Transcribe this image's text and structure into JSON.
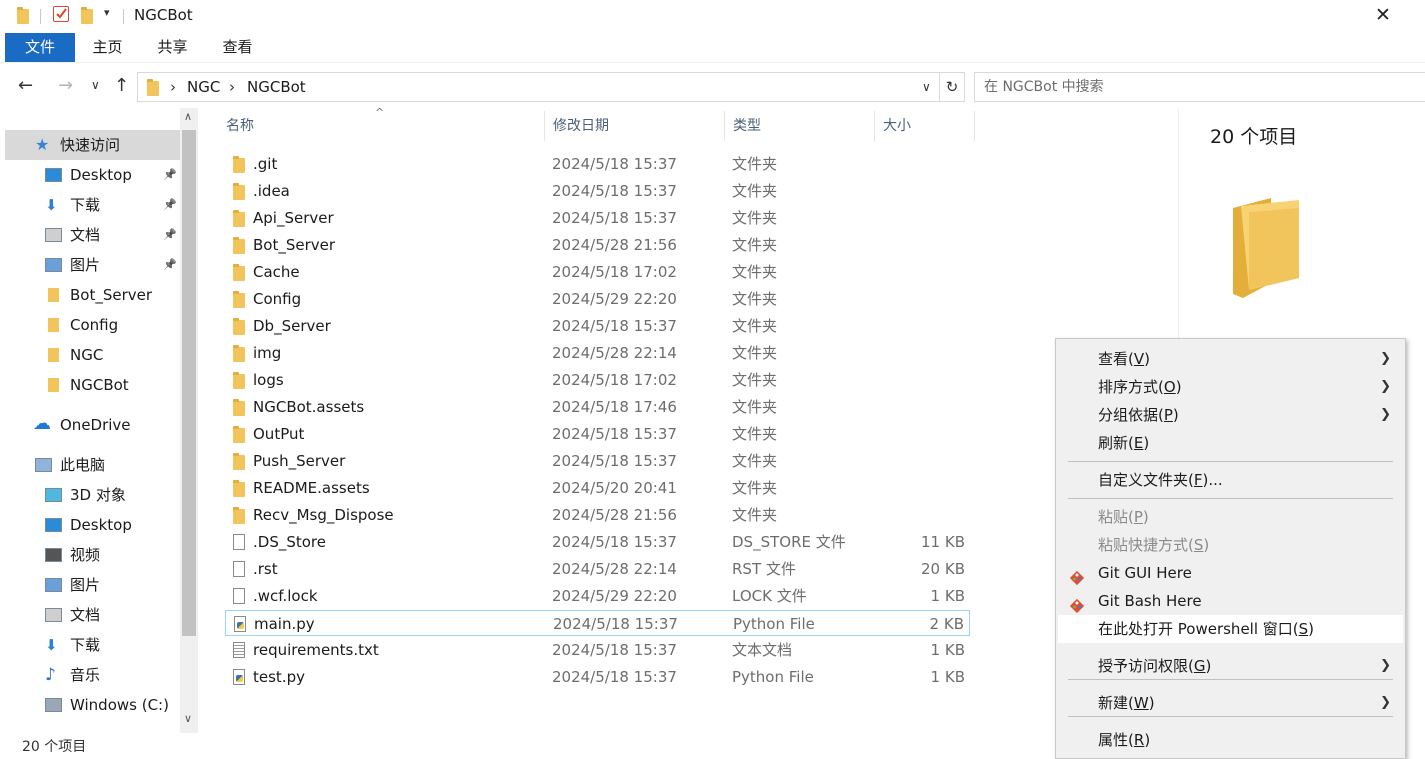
{
  "window": {
    "title": "NGCBot",
    "close_glyph": "✕"
  },
  "ribbon": {
    "tabs": [
      "文件",
      "主页",
      "共享",
      "查看"
    ]
  },
  "address": {
    "breadcrumbs": [
      "NGC",
      "NGCBot"
    ],
    "search_placeholder": "在 NGCBot 中搜索"
  },
  "nav": {
    "items": [
      {
        "label": "快速访问",
        "icon": "star-icon",
        "pinned": false
      },
      {
        "label": "Desktop",
        "icon": "desktop-icon",
        "pinned": true
      },
      {
        "label": "下载",
        "icon": "download-icon",
        "pinned": true
      },
      {
        "label": "文档",
        "icon": "document-icon",
        "pinned": true
      },
      {
        "label": "图片",
        "icon": "picture-icon",
        "pinned": true
      },
      {
        "label": "Bot_Server",
        "icon": "folder-icon",
        "pinned": false
      },
      {
        "label": "Config",
        "icon": "folder-icon",
        "pinned": false
      },
      {
        "label": "NGC",
        "icon": "folder-icon",
        "pinned": false
      },
      {
        "label": "NGCBot",
        "icon": "folder-icon",
        "pinned": false
      },
      {
        "label": "OneDrive",
        "icon": "onedrive-icon",
        "pinned": false
      },
      {
        "label": "此电脑",
        "icon": "pc-icon",
        "pinned": false
      },
      {
        "label": "3D 对象",
        "icon": "3d-objects-icon",
        "pinned": false
      },
      {
        "label": "Desktop",
        "icon": "desktop-icon",
        "pinned": false
      },
      {
        "label": "视频",
        "icon": "video-icon",
        "pinned": false
      },
      {
        "label": "图片",
        "icon": "picture-icon",
        "pinned": false
      },
      {
        "label": "文档",
        "icon": "document-icon",
        "pinned": false
      },
      {
        "label": "下载",
        "icon": "download-icon",
        "pinned": false
      },
      {
        "label": "音乐",
        "icon": "music-icon",
        "pinned": false
      },
      {
        "label": "Windows (C:)",
        "icon": "drive-icon",
        "pinned": false
      }
    ]
  },
  "columns": {
    "name": "名称",
    "date": "修改日期",
    "type": "类型",
    "size": "大小"
  },
  "files": [
    {
      "name": ".git",
      "date": "2024/5/18 15:37",
      "type": "文件夹",
      "size": "",
      "kind": "folder"
    },
    {
      "name": ".idea",
      "date": "2024/5/18 15:37",
      "type": "文件夹",
      "size": "",
      "kind": "folder"
    },
    {
      "name": "Api_Server",
      "date": "2024/5/18 15:37",
      "type": "文件夹",
      "size": "",
      "kind": "folder"
    },
    {
      "name": "Bot_Server",
      "date": "2024/5/28 21:56",
      "type": "文件夹",
      "size": "",
      "kind": "folder"
    },
    {
      "name": "Cache",
      "date": "2024/5/18 17:02",
      "type": "文件夹",
      "size": "",
      "kind": "folder"
    },
    {
      "name": "Config",
      "date": "2024/5/29 22:20",
      "type": "文件夹",
      "size": "",
      "kind": "folder"
    },
    {
      "name": "Db_Server",
      "date": "2024/5/18 15:37",
      "type": "文件夹",
      "size": "",
      "kind": "folder"
    },
    {
      "name": "img",
      "date": "2024/5/28 22:14",
      "type": "文件夹",
      "size": "",
      "kind": "folder"
    },
    {
      "name": "logs",
      "date": "2024/5/18 17:02",
      "type": "文件夹",
      "size": "",
      "kind": "folder"
    },
    {
      "name": "NGCBot.assets",
      "date": "2024/5/18 17:46",
      "type": "文件夹",
      "size": "",
      "kind": "folder"
    },
    {
      "name": "OutPut",
      "date": "2024/5/18 15:37",
      "type": "文件夹",
      "size": "",
      "kind": "folder"
    },
    {
      "name": "Push_Server",
      "date": "2024/5/18 15:37",
      "type": "文件夹",
      "size": "",
      "kind": "folder"
    },
    {
      "name": "README.assets",
      "date": "2024/5/20 20:41",
      "type": "文件夹",
      "size": "",
      "kind": "folder"
    },
    {
      "name": "Recv_Msg_Dispose",
      "date": "2024/5/28 21:56",
      "type": "文件夹",
      "size": "",
      "kind": "folder"
    },
    {
      "name": ".DS_Store",
      "date": "2024/5/18 15:37",
      "type": "DS_STORE 文件",
      "size": "11 KB",
      "kind": "file"
    },
    {
      "name": ".rst",
      "date": "2024/5/28 22:14",
      "type": "RST 文件",
      "size": "20 KB",
      "kind": "file"
    },
    {
      "name": ".wcf.lock",
      "date": "2024/5/29 22:20",
      "type": "LOCK 文件",
      "size": "1 KB",
      "kind": "file"
    },
    {
      "name": "main.py",
      "date": "2024/5/18 15:37",
      "type": "Python File",
      "size": "2 KB",
      "kind": "python"
    },
    {
      "name": "requirements.txt",
      "date": "2024/5/18 15:37",
      "type": "文本文档",
      "size": "1 KB",
      "kind": "text"
    },
    {
      "name": "test.py",
      "date": "2024/5/18 15:37",
      "type": "Python File",
      "size": "1 KB",
      "kind": "python"
    }
  ],
  "preview": {
    "count_text": "20 个项目"
  },
  "status": {
    "count_text": "20 个项目"
  },
  "context_menu": {
    "items": [
      {
        "label": "查看",
        "key": "V",
        "suffix": "",
        "submenu": true,
        "disabled": false
      },
      {
        "label": "排序方式",
        "key": "O",
        "suffix": "",
        "submenu": true,
        "disabled": false
      },
      {
        "label": "分组依据",
        "key": "P",
        "suffix": "",
        "submenu": true,
        "disabled": false
      },
      {
        "label": "刷新",
        "key": "E",
        "suffix": "",
        "submenu": false,
        "disabled": false
      },
      {
        "label": "自定义文件夹",
        "key": "F",
        "suffix": "...",
        "submenu": false,
        "disabled": false
      },
      {
        "label": "粘贴",
        "key": "P",
        "suffix": "",
        "submenu": false,
        "disabled": true
      },
      {
        "label": "粘贴快捷方式",
        "key": "S",
        "suffix": "",
        "submenu": false,
        "disabled": true
      },
      {
        "label": "Git GUI Here",
        "submenu": false,
        "disabled": false
      },
      {
        "label": "Git Bash Here",
        "submenu": false,
        "disabled": false
      },
      {
        "label": "在此处打开 Powershell 窗口",
        "key": "S",
        "suffix": "",
        "submenu": false,
        "disabled": false
      },
      {
        "label": "授予访问权限",
        "key": "G",
        "suffix": "",
        "submenu": true,
        "disabled": false
      },
      {
        "label": "新建",
        "key": "W",
        "suffix": "",
        "submenu": true,
        "disabled": false
      },
      {
        "label": "属性",
        "key": "R",
        "suffix": "",
        "submenu": false,
        "disabled": false
      }
    ]
  },
  "colors": {
    "accent": "#1a6bc4",
    "folder": "#f2c55c",
    "selection_border": "#99d1ff",
    "menu_bg": "#f0f0f0"
  }
}
